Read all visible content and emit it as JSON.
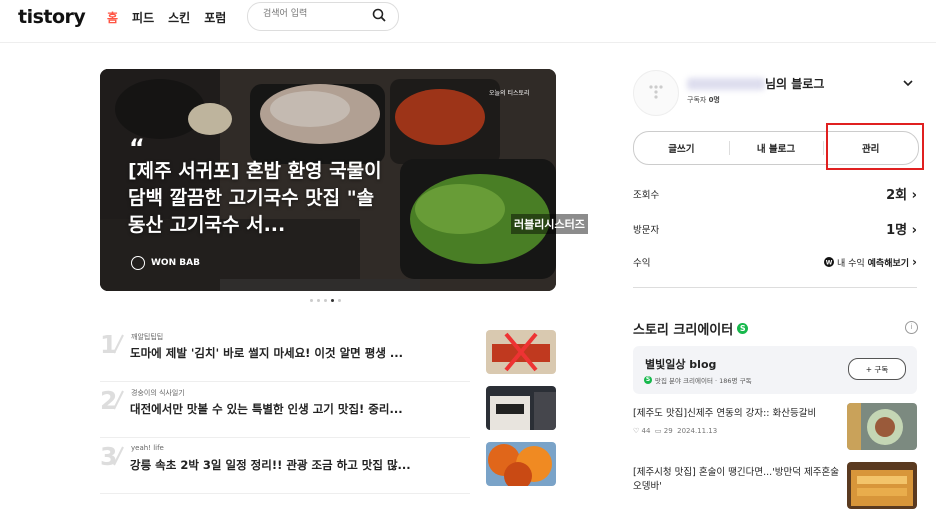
{
  "header": {
    "logo": "tistory",
    "nav": [
      "홈",
      "피드",
      "스킨",
      "포럼"
    ],
    "search_placeholder": "검색어 입력"
  },
  "hero": {
    "quote_mark": "“",
    "title": "[제주 서귀포] 혼밥 환영 국물이 담백 깔끔한 고기국수 맛집 \"솔동산 고기국수 서...",
    "author": "WON BAB",
    "corner_tag": "오늘의 티스토리",
    "stamp": "러블리시스터즈"
  },
  "ranked": [
    {
      "num": "1",
      "source": "깨알팁팁팁",
      "title": "도마에 제발 '김치' 바로 썰지 마세요! 이것 알면 평생 ..."
    },
    {
      "num": "2",
      "source": "경숭이의 식사일기",
      "title": "대전에서만 맛볼 수 있는 특별한 인생 고기 맛집! 중리..."
    },
    {
      "num": "3",
      "source": "yeah! life",
      "title": "강릉 속초 2박 3일 일정 정리!! 관광 조금 하고 맛집 많..."
    }
  ],
  "profile": {
    "name_suffix": "님의 블로그",
    "subscribers_label": "구독자",
    "subscribers_value": "0명"
  },
  "actions": [
    "글쓰기",
    "내 블로그",
    "관리"
  ],
  "stats": [
    {
      "label": "조회수",
      "value": "2회"
    },
    {
      "label": "방문자",
      "value": "1명"
    }
  ],
  "revenue": {
    "label": "수익",
    "prefix": "내 수익",
    "link": "예측해보기"
  },
  "creator": {
    "section_title": "스토리 크리에이터",
    "name": "별빛일상 blog",
    "meta": "맛집 분야 크리에이터 · 186명 구독",
    "subscribe": "+ 구독"
  },
  "posts": [
    {
      "title": "[제주도 맛집]신제주 연동의 강자:: 화산등갈비",
      "likes": "44",
      "comments": "29",
      "date": "2024.11.13"
    },
    {
      "title": "[제주시청 맛집] 혼술이 땡긴다면...'방만덕 제주혼술 오뎅바'"
    }
  ]
}
